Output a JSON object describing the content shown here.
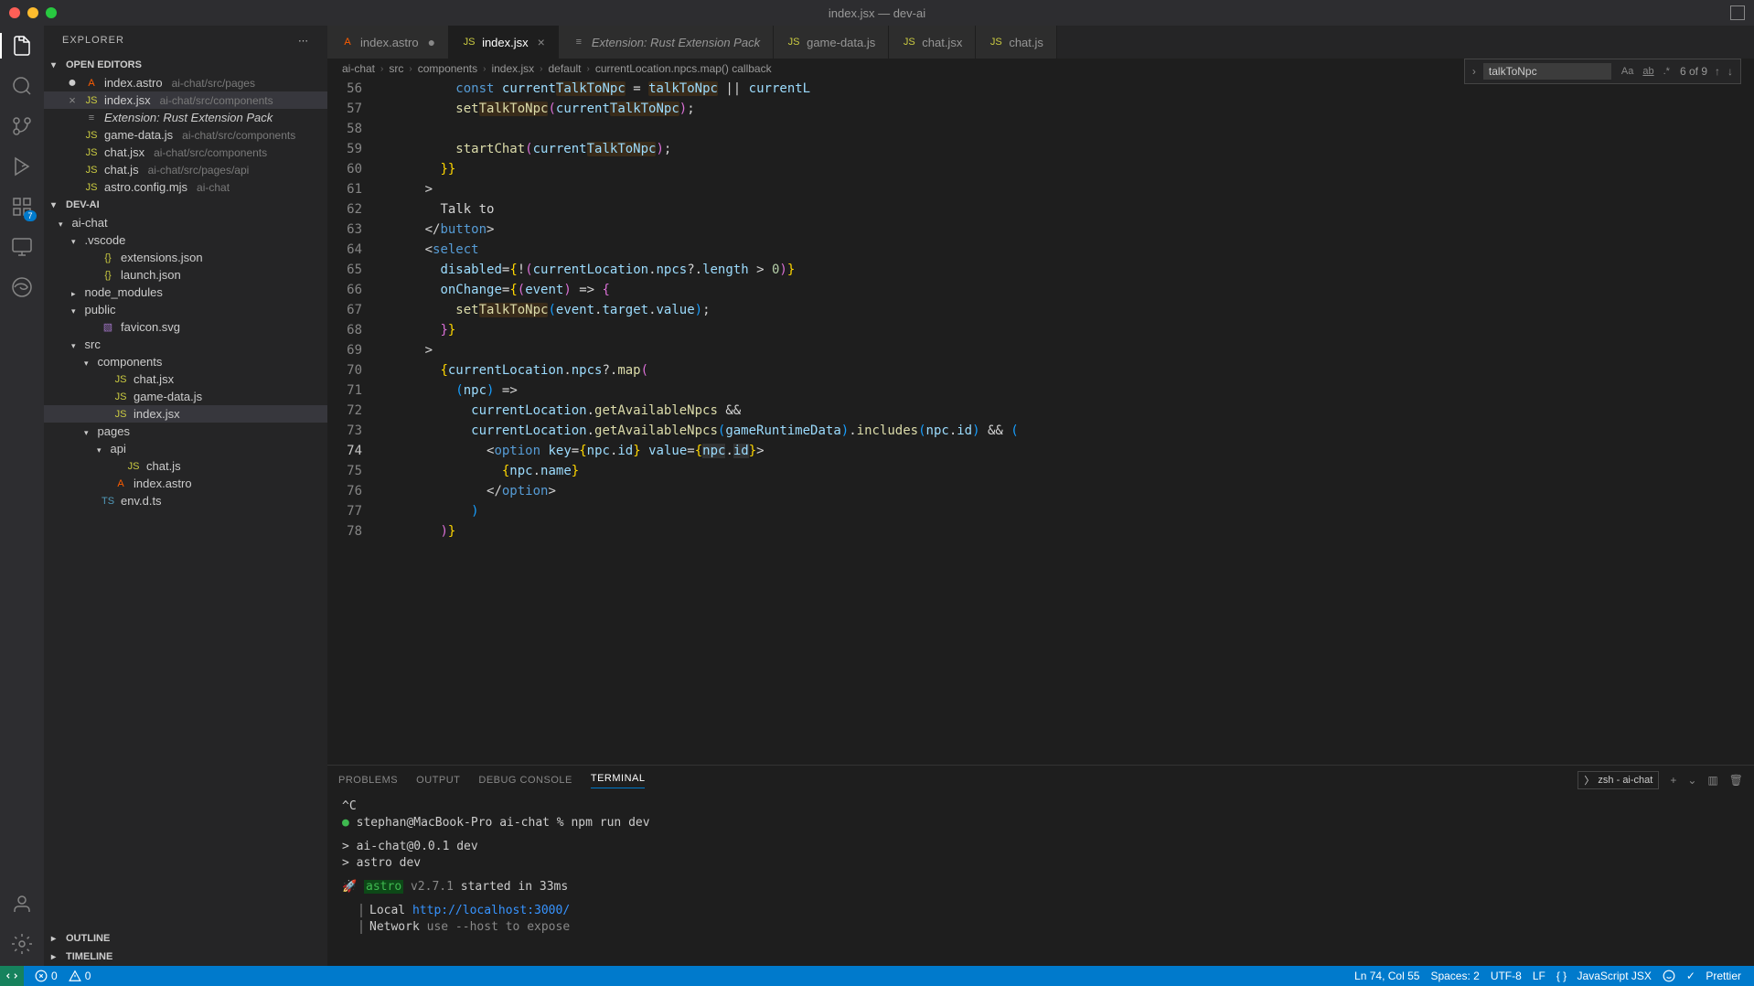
{
  "window": {
    "title": "index.jsx — dev-ai"
  },
  "explorer": {
    "title": "EXPLORER",
    "openEditorsLabel": "OPEN EDITORS",
    "projectLabel": "DEV-AI",
    "outlineLabel": "OUTLINE",
    "timelineLabel": "TIMELINE",
    "openEditors": [
      {
        "name": "index.astro",
        "path": "ai-chat/src/pages",
        "icon": "A",
        "iconClass": "fi-astro",
        "modified": true
      },
      {
        "name": "index.jsx",
        "path": "ai-chat/src/components",
        "icon": "JS",
        "iconClass": "fi-js",
        "active": true
      },
      {
        "name": "Extension: Rust Extension Pack",
        "path": "",
        "icon": "≡",
        "iconClass": "fi-ext",
        "italic": true
      },
      {
        "name": "game-data.js",
        "path": "ai-chat/src/components",
        "icon": "JS",
        "iconClass": "fi-js"
      },
      {
        "name": "chat.jsx",
        "path": "ai-chat/src/components",
        "icon": "JS",
        "iconClass": "fi-js"
      },
      {
        "name": "chat.js",
        "path": "ai-chat/src/pages/api",
        "icon": "JS",
        "iconClass": "fi-js"
      },
      {
        "name": "astro.config.mjs",
        "path": "ai-chat",
        "icon": "JS",
        "iconClass": "fi-js"
      }
    ],
    "tree": [
      {
        "type": "folder",
        "name": "ai-chat",
        "indent": 0,
        "open": true
      },
      {
        "type": "folder",
        "name": ".vscode",
        "indent": 1,
        "open": true
      },
      {
        "type": "file",
        "name": "extensions.json",
        "indent": 2,
        "icon": "{}",
        "iconClass": "fi-json"
      },
      {
        "type": "file",
        "name": "launch.json",
        "indent": 2,
        "icon": "{}",
        "iconClass": "fi-json"
      },
      {
        "type": "folder",
        "name": "node_modules",
        "indent": 1,
        "open": false
      },
      {
        "type": "folder",
        "name": "public",
        "indent": 1,
        "open": true
      },
      {
        "type": "file",
        "name": "favicon.svg",
        "indent": 2,
        "icon": "▧",
        "iconClass": "fi-svg"
      },
      {
        "type": "folder",
        "name": "src",
        "indent": 1,
        "open": true
      },
      {
        "type": "folder",
        "name": "components",
        "indent": 2,
        "open": true
      },
      {
        "type": "file",
        "name": "chat.jsx",
        "indent": 3,
        "icon": "JS",
        "iconClass": "fi-js"
      },
      {
        "type": "file",
        "name": "game-data.js",
        "indent": 3,
        "icon": "JS",
        "iconClass": "fi-js"
      },
      {
        "type": "file",
        "name": "index.jsx",
        "indent": 3,
        "icon": "JS",
        "iconClass": "fi-js",
        "active": true
      },
      {
        "type": "folder",
        "name": "pages",
        "indent": 2,
        "open": true
      },
      {
        "type": "folder",
        "name": "api",
        "indent": 3,
        "open": true
      },
      {
        "type": "file",
        "name": "chat.js",
        "indent": 4,
        "icon": "JS",
        "iconClass": "fi-js"
      },
      {
        "type": "file",
        "name": "index.astro",
        "indent": 3,
        "icon": "A",
        "iconClass": "fi-astro"
      },
      {
        "type": "file",
        "name": "env.d.ts",
        "indent": 2,
        "icon": "TS",
        "iconClass": "fi-ts"
      }
    ]
  },
  "tabs": [
    {
      "label": "index.astro",
      "icon": "A",
      "iconClass": "fi-astro",
      "modified": true
    },
    {
      "label": "index.jsx",
      "icon": "JS",
      "iconClass": "fi-js",
      "active": true,
      "close": true
    },
    {
      "label": "Extension: Rust Extension Pack",
      "icon": "≡",
      "iconClass": "fi-ext",
      "italic": true
    },
    {
      "label": "game-data.js",
      "icon": "JS",
      "iconClass": "fi-js"
    },
    {
      "label": "chat.jsx",
      "icon": "JS",
      "iconClass": "fi-js"
    },
    {
      "label": "chat.js",
      "icon": "JS",
      "iconClass": "fi-js"
    }
  ],
  "breadcrumb": [
    "ai-chat",
    "src",
    "components",
    "index.jsx",
    "default",
    "currentLocation.npcs.map() callback"
  ],
  "find": {
    "value": "talkToNpc",
    "count": "6 of 9"
  },
  "code": {
    "startLine": 56,
    "activeLine": 74,
    "lines": [
      "          const currentTalkToNpc = talkToNpc || currentL",
      "          setTalkToNpc(currentTalkToNpc);",
      "",
      "          startChat(currentTalkToNpc);",
      "        }}",
      "      >",
      "        Talk to",
      "      </button>",
      "      <select",
      "        disabled={!(currentLocation.npcs?.length > 0)}",
      "        onChange={(event) => {",
      "          setTalkToNpc(event.target.value);",
      "        }}",
      "      >",
      "        {currentLocation.npcs?.map(",
      "          (npc) =>",
      "            currentLocation.getAvailableNpcs &&",
      "            currentLocation.getAvailableNpcs(gameRuntimeData).includes(npc.id) && (",
      "              <option key={npc.id} value={npc.id}>",
      "                {npc.name}",
      "              </option>",
      "            )",
      "        )}"
    ]
  },
  "panel": {
    "tabs": [
      "PROBLEMS",
      "OUTPUT",
      "DEBUG CONSOLE",
      "TERMINAL"
    ],
    "activeTab": "TERMINAL",
    "terminalName": "zsh - ai-chat",
    "terminal": {
      "line1": "^C",
      "prompt": "stephan@MacBook-Pro ai-chat % npm run dev",
      "line3": "> ai-chat@0.0.1 dev",
      "line4": "> astro dev",
      "astroLabel": "astro",
      "astroVersion": "v2.7.1",
      "astroStarted": "started in 33ms",
      "localLabel": "Local",
      "localUrl": "http://localhost:3000/",
      "networkLabel": "Network",
      "networkHint": "use --host to expose"
    }
  },
  "status": {
    "errors": "0",
    "warnings": "0",
    "position": "Ln 74, Col 55",
    "spaces": "Spaces: 2",
    "encoding": "UTF-8",
    "eol": "LF",
    "lang": "JavaScript JSX",
    "prettier": "Prettier"
  },
  "activity": {
    "extensionsBadge": "7"
  }
}
